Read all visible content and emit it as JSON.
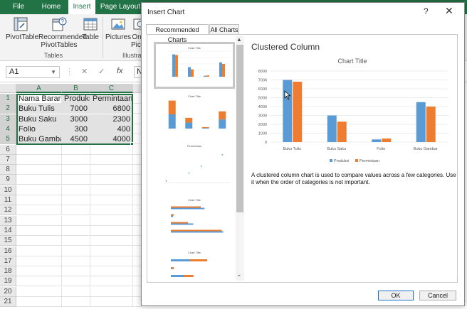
{
  "ribbon": {
    "tabs": [
      "File",
      "Home",
      "Insert",
      "Page Layout"
    ],
    "active_tab": "Insert",
    "buttons": {
      "pivottable": "PivotTable",
      "recommended_line1": "Recommended",
      "recommended_line2": "PivotTables",
      "table": "Table",
      "pictures": "Pictures",
      "online_line1": "On",
      "online_line2": "Pict"
    },
    "groups": {
      "tables": "Tables",
      "illustrations": "Illustrat"
    }
  },
  "formula_bar": {
    "name_box": "A1",
    "cancel_symbol": "✕",
    "enter_symbol": "✓",
    "fx_symbol": "fx",
    "formula": "N"
  },
  "sheet": {
    "columns": [
      "A",
      "B",
      "C"
    ],
    "rows": [
      "1",
      "2",
      "3",
      "4",
      "5",
      "6",
      "7",
      "8",
      "9",
      "10",
      "11",
      "12",
      "13",
      "14",
      "15",
      "16",
      "17",
      "18",
      "19",
      "20",
      "21"
    ],
    "cells": [
      [
        "Nama Barang",
        "Produksi",
        "Permintaan"
      ],
      [
        "Buku Tulis",
        "7000",
        "6800"
      ],
      [
        "Buku Saku",
        "3000",
        "2300"
      ],
      [
        "Folio",
        "300",
        "400"
      ],
      [
        "Buku Gambar",
        "4500",
        "4000"
      ]
    ]
  },
  "dialog": {
    "title": "Insert Chart",
    "help": "?",
    "close": "✕",
    "tabs": [
      "Recommended Charts",
      "All Charts"
    ],
    "active_tab": "Recommended Charts",
    "preview_title": "Clustered Column",
    "description": "A clustered column chart is used to compare values across a few categories. Use it when the order of categories is not important.",
    "thumb_titles": [
      "Chart Title",
      "Chart Title",
      "Permintaan",
      "Chart Title",
      "Chart Title"
    ],
    "ok": "OK",
    "cancel": "Cancel"
  },
  "chart_data": {
    "type": "bar",
    "title": "Chart Title",
    "categories": [
      "Buku Tulis",
      "Buku Saku",
      "Folio",
      "Buku Gambar"
    ],
    "series": [
      {
        "name": "Produksi",
        "values": [
          7000,
          3000,
          300,
          4500
        ],
        "color": "#5b9bd5"
      },
      {
        "name": "Permintaan",
        "values": [
          6800,
          2300,
          400,
          4000
        ],
        "color": "#ed7d31"
      }
    ],
    "yticks": [
      0,
      1000,
      2000,
      3000,
      4000,
      5000,
      6000,
      7000,
      8000
    ],
    "ylim": [
      0,
      8000
    ],
    "legend": "bottom",
    "grid": true
  },
  "colors": {
    "excel_green": "#217346",
    "series1": "#5b9bd5",
    "series2": "#ed7d31"
  },
  "icons": [
    "pivottable-icon",
    "recommended-pivottables-icon",
    "table-icon",
    "pictures-icon",
    "online-pictures-icon",
    "dropdown-arrow-icon",
    "mouse-cursor-icon"
  ]
}
